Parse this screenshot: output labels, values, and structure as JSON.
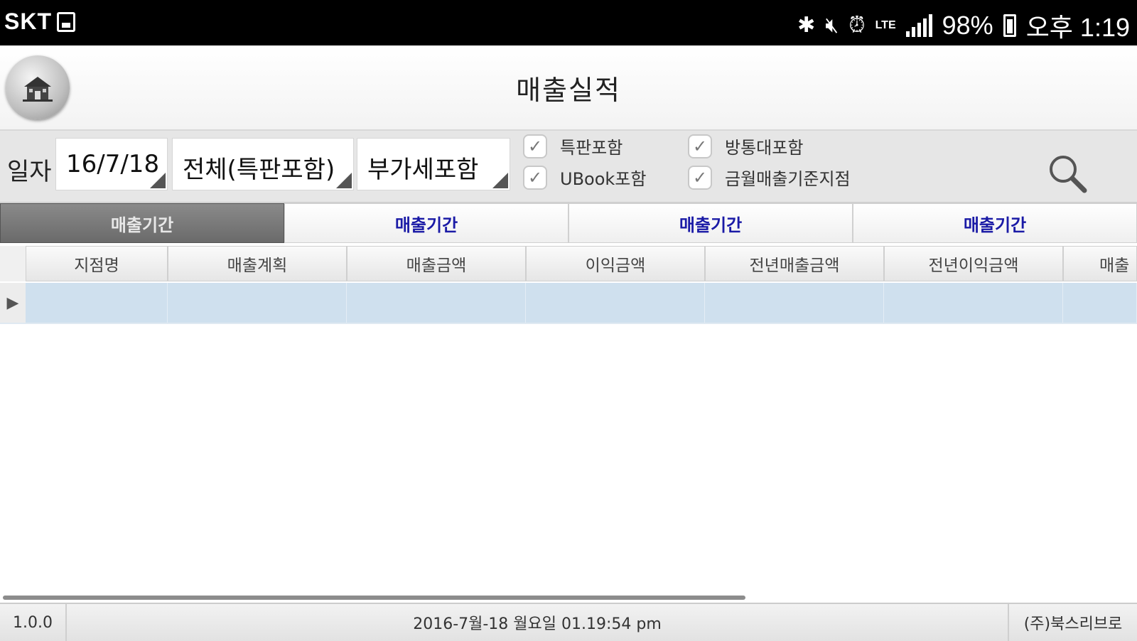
{
  "status_bar": {
    "carrier": "SKT",
    "network": "LTE",
    "battery": "98%",
    "time": "오후 1:19",
    "icons": [
      "gallery-icon",
      "bluetooth-icon",
      "mute-icon",
      "alarm-icon",
      "signal-icon",
      "battery-icon"
    ]
  },
  "header": {
    "title": "매출실적",
    "logo_icon": "home-logo-icon"
  },
  "filters": {
    "date_label": "일자",
    "date_value": "16/7/18",
    "scope_value": "전체(특판포함)",
    "vat_value": "부가세포함",
    "checkboxes": [
      {
        "label": "특판포함",
        "checked": true
      },
      {
        "label": "방통대포함",
        "checked": true
      },
      {
        "label": "UBook포함",
        "checked": true
      },
      {
        "label": "금월매출기준지점",
        "checked": true
      }
    ],
    "search_icon": "search-icon"
  },
  "tabs": [
    {
      "label": "매출기간",
      "active": true
    },
    {
      "label": "매출기간",
      "active": false
    },
    {
      "label": "매출기간",
      "active": false
    },
    {
      "label": "매출기간",
      "active": false
    }
  ],
  "grid": {
    "columns": [
      "지점명",
      "매출계획",
      "매출금액",
      "이익금액",
      "전년매출금액",
      "전년이익금액",
      "매출"
    ],
    "rows": [
      [
        "",
        "",
        "",
        "",
        "",
        "",
        ""
      ]
    ]
  },
  "footer": {
    "version": "1.0.0",
    "datetime": "2016-7월-18 월요일 01.19:54 pm",
    "company": "(주)북스리브로"
  },
  "colors": {
    "tab_text": "#1a1aa6",
    "selected_row": "#cfe0ee",
    "active_tab": "#6a6a6a"
  }
}
